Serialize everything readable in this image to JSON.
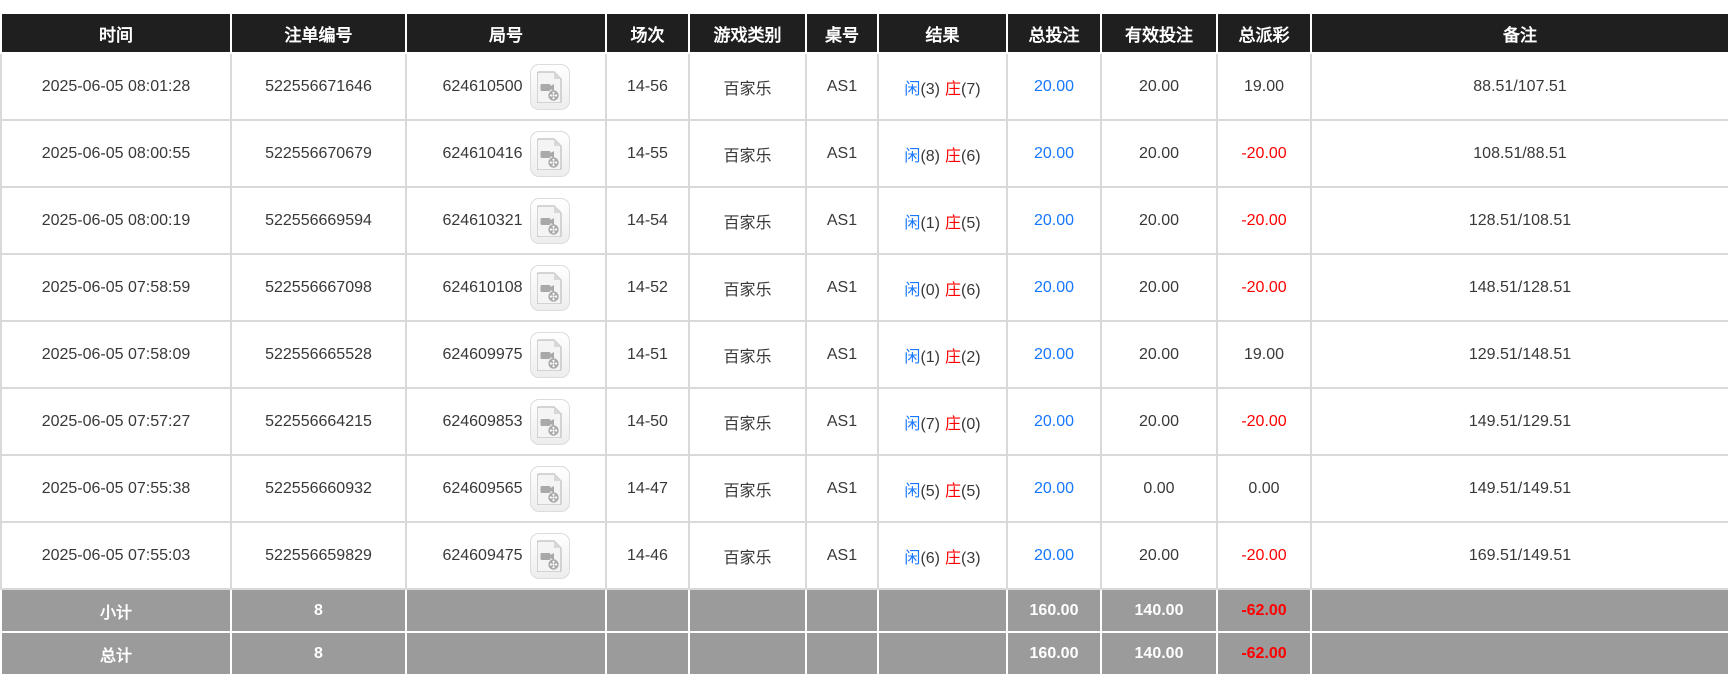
{
  "colors": {
    "header_bg": "#1f1f1f",
    "header_text": "#ffffff",
    "body_text": "#383838",
    "bet_blue": "#1677ff",
    "loss_red": "#ff0000",
    "summary_bg": "#9b9b9b",
    "border": "#d9d9d9"
  },
  "icons": {
    "round_video": "video-file-icon"
  },
  "table": {
    "columns": [
      {
        "key": "time",
        "label": "时间"
      },
      {
        "key": "bet_id",
        "label": "注单编号"
      },
      {
        "key": "round",
        "label": "局号"
      },
      {
        "key": "session",
        "label": "场次"
      },
      {
        "key": "game",
        "label": "游戏类别"
      },
      {
        "key": "table_no",
        "label": "桌号"
      },
      {
        "key": "result",
        "label": "结果"
      },
      {
        "key": "total_bet",
        "label": "总投注"
      },
      {
        "key": "valid_bet",
        "label": "有效投注"
      },
      {
        "key": "payout",
        "label": "总派彩"
      },
      {
        "key": "remark",
        "label": "备注"
      }
    ],
    "result_labels": {
      "player": "闲",
      "banker": "庄"
    },
    "rows": [
      {
        "time": "2025-06-05 08:01:28",
        "bet_id": "522556671646",
        "round": "624610500",
        "session": "14-56",
        "game": "百家乐",
        "table_no": "AS1",
        "player": "(3)",
        "banker": "(7)",
        "total_bet": "20.00",
        "valid_bet": "20.00",
        "payout": "19.00",
        "remark": "88.51/107.51"
      },
      {
        "time": "2025-06-05 08:00:55",
        "bet_id": "522556670679",
        "round": "624610416",
        "session": "14-55",
        "game": "百家乐",
        "table_no": "AS1",
        "player": "(8)",
        "banker": "(6)",
        "total_bet": "20.00",
        "valid_bet": "20.00",
        "payout": "-20.00",
        "remark": "108.51/88.51"
      },
      {
        "time": "2025-06-05 08:00:19",
        "bet_id": "522556669594",
        "round": "624610321",
        "session": "14-54",
        "game": "百家乐",
        "table_no": "AS1",
        "player": "(1)",
        "banker": "(5)",
        "total_bet": "20.00",
        "valid_bet": "20.00",
        "payout": "-20.00",
        "remark": "128.51/108.51"
      },
      {
        "time": "2025-06-05 07:58:59",
        "bet_id": "522556667098",
        "round": "624610108",
        "session": "14-52",
        "game": "百家乐",
        "table_no": "AS1",
        "player": "(0)",
        "banker": "(6)",
        "total_bet": "20.00",
        "valid_bet": "20.00",
        "payout": "-20.00",
        "remark": "148.51/128.51"
      },
      {
        "time": "2025-06-05 07:58:09",
        "bet_id": "522556665528",
        "round": "624609975",
        "session": "14-51",
        "game": "百家乐",
        "table_no": "AS1",
        "player": "(1)",
        "banker": "(2)",
        "total_bet": "20.00",
        "valid_bet": "20.00",
        "payout": "19.00",
        "remark": "129.51/148.51"
      },
      {
        "time": "2025-06-05 07:57:27",
        "bet_id": "522556664215",
        "round": "624609853",
        "session": "14-50",
        "game": "百家乐",
        "table_no": "AS1",
        "player": "(7)",
        "banker": "(0)",
        "total_bet": "20.00",
        "valid_bet": "20.00",
        "payout": "-20.00",
        "remark": "149.51/129.51"
      },
      {
        "time": "2025-06-05 07:55:38",
        "bet_id": "522556660932",
        "round": "624609565",
        "session": "14-47",
        "game": "百家乐",
        "table_no": "AS1",
        "player": "(5)",
        "banker": "(5)",
        "total_bet": "20.00",
        "valid_bet": "0.00",
        "payout": "0.00",
        "remark": "149.51/149.51"
      },
      {
        "time": "2025-06-05 07:55:03",
        "bet_id": "522556659829",
        "round": "624609475",
        "session": "14-46",
        "game": "百家乐",
        "table_no": "AS1",
        "player": "(6)",
        "banker": "(3)",
        "total_bet": "20.00",
        "valid_bet": "20.00",
        "payout": "-20.00",
        "remark": "169.51/149.51"
      }
    ],
    "summary_rows": [
      {
        "label": "小计",
        "count": "8",
        "total_bet": "160.00",
        "valid_bet": "140.00",
        "payout": "-62.00"
      },
      {
        "label": "总计",
        "count": "8",
        "total_bet": "160.00",
        "valid_bet": "140.00",
        "payout": "-62.00"
      }
    ]
  }
}
